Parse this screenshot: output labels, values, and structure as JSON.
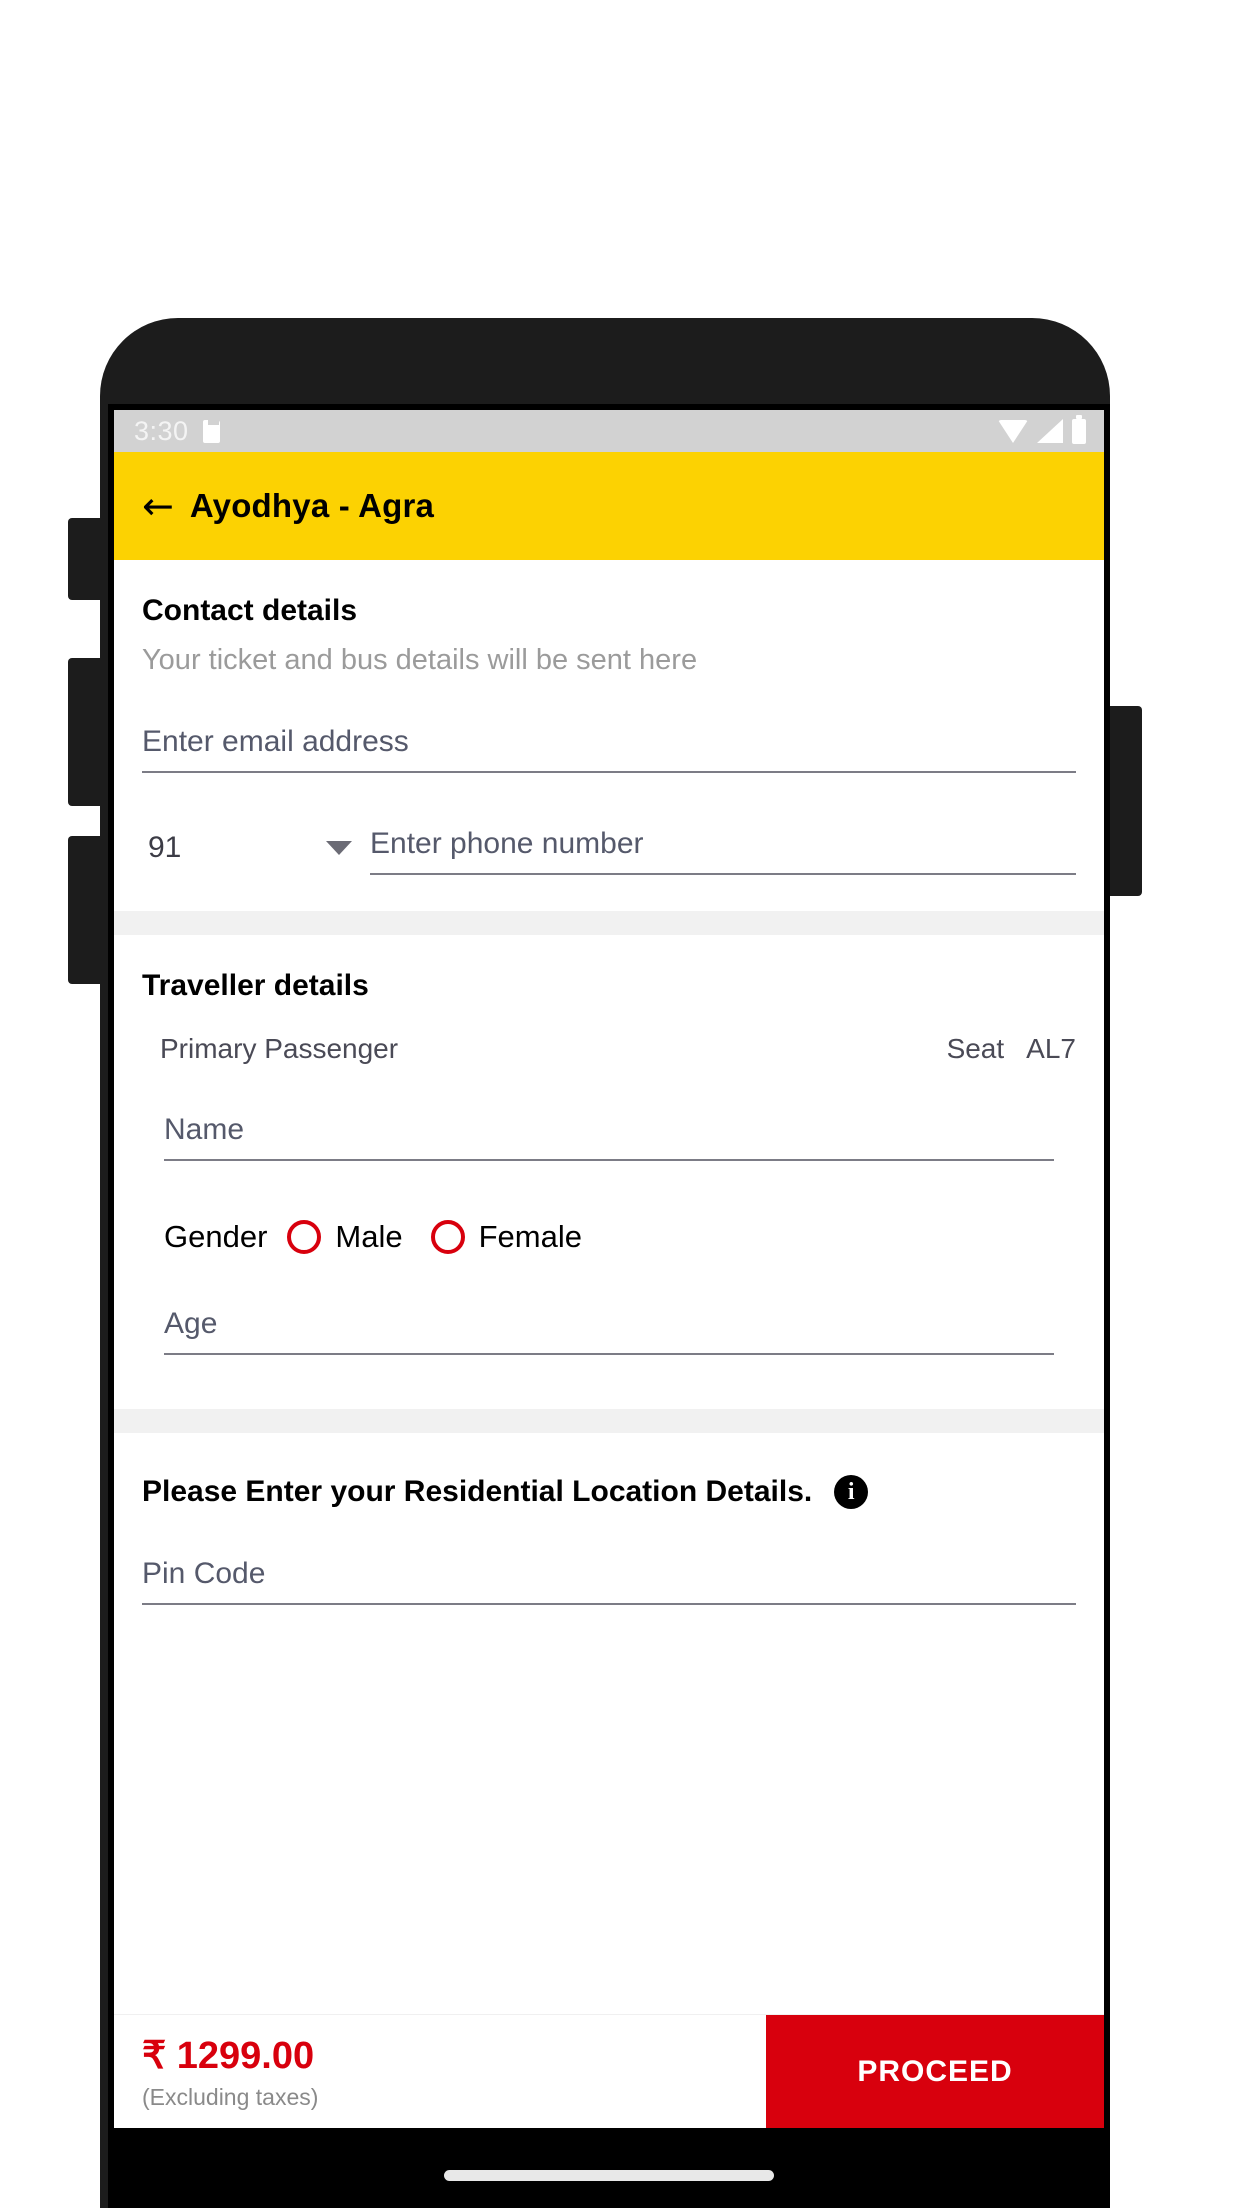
{
  "status_bar": {
    "time": "3:30",
    "icons": [
      "sd-card-icon",
      "wifi-icon",
      "signal-icon",
      "battery-icon"
    ]
  },
  "app_bar": {
    "back_icon": "back-arrow-icon",
    "title": "Ayodhya - Agra"
  },
  "contact": {
    "title": "Contact details",
    "subtitle": "Your ticket and bus details will be sent here",
    "email_placeholder": "Enter email address",
    "country_code": "91",
    "phone_placeholder": "Enter phone number"
  },
  "traveller": {
    "title": "Traveller details",
    "passenger_label": "Primary Passenger",
    "seat_label": "Seat",
    "seat_value": "AL7",
    "name_placeholder": "Name",
    "gender_label": "Gender",
    "gender_options": [
      "Male",
      "Female"
    ],
    "age_placeholder": "Age"
  },
  "residential": {
    "heading": "Please Enter your Residential Location Details.",
    "info_icon": "i",
    "pin_placeholder": "Pin Code"
  },
  "bottom_bar": {
    "price": "₹ 1299.00",
    "price_note": "(Excluding taxes)",
    "proceed_label": "PROCEED"
  },
  "colors": {
    "brand_yellow": "#fcd202",
    "accent_red": "#d8000d",
    "status_bar": "#d2d2d2"
  }
}
